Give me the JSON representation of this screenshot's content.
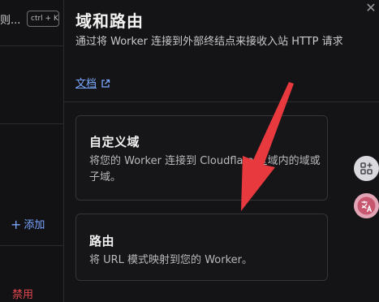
{
  "background": {
    "truncated_title": "则...",
    "shortcut": "ctrl + K",
    "add_label": "添加",
    "disable_label": "禁用"
  },
  "panel": {
    "title": "域和路由",
    "description": "通过将 Worker 连接到外部终结点来接收入站 HTTP 请求",
    "docs_link": "文档"
  },
  "options": [
    {
      "title": "自定义域",
      "description": "将您的 Worker 连接到 Cloudflare 区域内的域或子域。"
    },
    {
      "title": "路由",
      "description": "将 URL 模式映射到您的 Worker。"
    }
  ],
  "colors": {
    "link": "#7aa7ff",
    "danger": "#e0464e",
    "annotation_arrow": "#e8393f"
  },
  "icons": {
    "close": "close-icon",
    "external_link": "external-link-icon",
    "add": "plus-icon",
    "apps": "apps-icon",
    "translate": "translate-icon"
  }
}
